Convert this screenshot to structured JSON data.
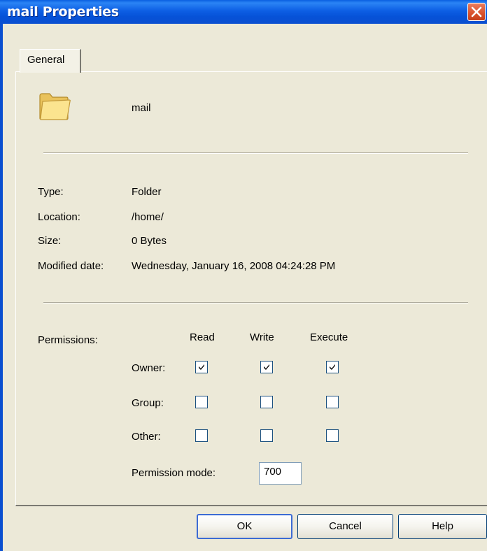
{
  "window": {
    "title": "mail Properties"
  },
  "tabs": [
    {
      "label": "General"
    }
  ],
  "item": {
    "name": "mail",
    "icon": "folder-icon"
  },
  "info": {
    "type_label": "Type:",
    "type_value": "Folder",
    "location_label": "Location:",
    "location_value": "/home/",
    "size_label": "Size:",
    "size_value": "0 Bytes",
    "modified_label": "Modified date:",
    "modified_value": "Wednesday, January 16, 2008 04:24:28 PM"
  },
  "permissions": {
    "label": "Permissions:",
    "columns": [
      "Read",
      "Write",
      "Execute"
    ],
    "rows": [
      {
        "label": "Owner:",
        "read": true,
        "write": true,
        "execute": true
      },
      {
        "label": "Group:",
        "read": false,
        "write": false,
        "execute": false
      },
      {
        "label": "Other:",
        "read": false,
        "write": false,
        "execute": false
      }
    ],
    "mode_label": "Permission mode:",
    "mode_value": "700"
  },
  "buttons": {
    "ok": "OK",
    "cancel": "Cancel",
    "help": "Help"
  },
  "colors": {
    "titlebar": "#0a5fe0",
    "dialog_bg": "#ece9d8",
    "close": "#d9512c"
  }
}
